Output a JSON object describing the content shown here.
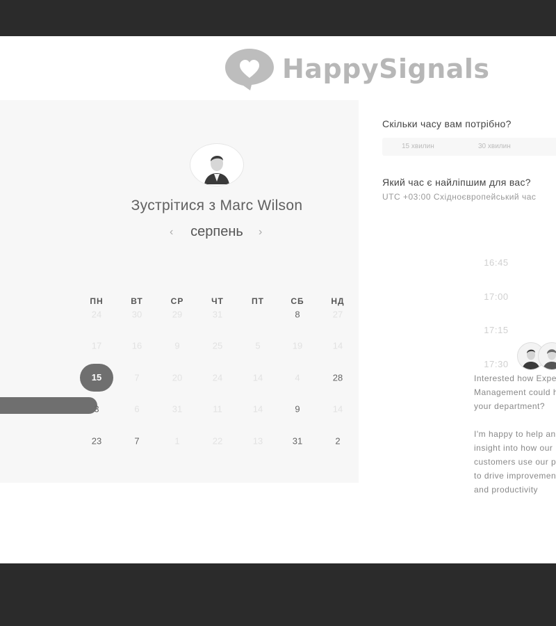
{
  "brand": {
    "name": "HappySignals"
  },
  "calendar": {
    "title": "Зустрітися з Marc Wilson",
    "prev_icon": "‹",
    "next_icon": "›",
    "month": "серпень",
    "weekdays": [
      "ПН",
      "ВТ",
      "СР",
      "ЧТ",
      "ПТ",
      "СБ",
      "НД"
    ],
    "rows": [
      [
        "24",
        "30",
        "29",
        "31",
        "",
        "8",
        "27"
      ],
      [
        "17",
        "16",
        "9",
        "25",
        "5",
        "19",
        "14"
      ],
      [
        "15",
        "7",
        "20",
        "24",
        "14",
        "4",
        "28"
      ],
      [
        "3",
        "6",
        "31",
        "11",
        "14",
        "9",
        "14"
      ],
      [
        "23",
        "7",
        "1",
        "22",
        "13",
        "31",
        "2"
      ]
    ],
    "selected": "15"
  },
  "booking": {
    "duration_question": "Скільки часу вам потрібно?",
    "durations": [
      "15 хвилин",
      "30 хвилин"
    ],
    "time_question": "Який час є найліпшим для вас?",
    "timezone": "UTC +03:00 Східноєвропейський час",
    "slots": [
      "16:45",
      "17:00",
      "17:15",
      "17:30"
    ]
  },
  "chat": {
    "paragraph1": "Interested how Experience Management could help your department?",
    "paragraph2": "I'm happy to help and give insight into how our customers use our platform to drive improvement in IT and productivity"
  },
  "colors": {
    "selected_day": "#6f6f6f",
    "panel_bg": "#f7f7f7",
    "logo": "#b7b7b7"
  }
}
